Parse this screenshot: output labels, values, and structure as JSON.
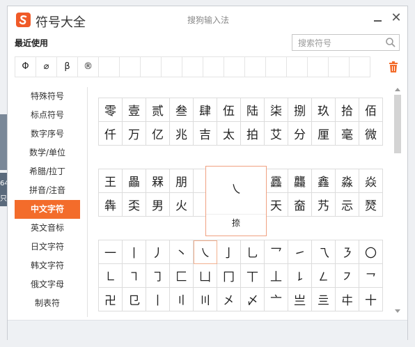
{
  "app": {
    "name": "符号大全",
    "window_title": "搜狗输入法"
  },
  "recent": {
    "label": "最近使用",
    "symbols": [
      "Φ",
      "⌀",
      "β",
      "®",
      "",
      "",
      "",
      "",
      "",
      "",
      "",
      "",
      "",
      "",
      "",
      "",
      ""
    ]
  },
  "search": {
    "placeholder": "搜索符号"
  },
  "sidebar": {
    "items": [
      {
        "label": "特殊符号"
      },
      {
        "label": "标点符号"
      },
      {
        "label": "数字序号"
      },
      {
        "label": "数学/单位"
      },
      {
        "label": "希腊/拉丁"
      },
      {
        "label": "拼音/注音"
      },
      {
        "label": "中文字符",
        "active": true
      },
      {
        "label": "英文音标"
      },
      {
        "label": "日文字符"
      },
      {
        "label": "韩文字符"
      },
      {
        "label": "俄文字母"
      },
      {
        "label": "制表符"
      }
    ]
  },
  "grids": [
    {
      "rows": [
        [
          "零",
          "壹",
          "贰",
          "叁",
          "肆",
          "伍",
          "陆",
          "柒",
          "捌",
          "玖",
          "拾",
          "佰"
        ],
        [
          "仟",
          "万",
          "亿",
          "兆",
          "吉",
          "太",
          "拍",
          "艾",
          "分",
          "厘",
          "毫",
          "微"
        ]
      ]
    },
    {
      "rows": [
        [
          "王",
          "畾",
          "槑",
          "朋",
          "",
          "",
          "",
          "靐",
          "龘",
          "鑫",
          "淼",
          "焱"
        ],
        [
          "犇",
          "奀",
          "男",
          "火",
          "",
          "",
          "",
          "天",
          "奤",
          "艿",
          "忈",
          "燹"
        ]
      ]
    },
    {
      "rows": [
        [
          "一",
          "丨",
          "丿",
          "丶",
          "㇏",
          "亅",
          "乚",
          "乛",
          "㇀",
          "乁",
          "㇋",
          "〇"
        ],
        [
          "㇗",
          "㇕",
          "㇆",
          "匚",
          "凵",
          "冂",
          "丅",
          "丄",
          "㇙",
          "㇜",
          "㇇",
          "㇖"
        ],
        [
          "卍",
          "㔾",
          "丨",
          "〢",
          "〣",
          "㐅",
          "〆",
          "亠",
          "亗",
          "亖",
          "㐄",
          "十"
        ]
      ]
    }
  ],
  "tooltip": {
    "symbol": "㇏",
    "name": "捺"
  },
  "colors": {
    "accent": "#f36c2b",
    "brand": "#f05a28"
  }
}
